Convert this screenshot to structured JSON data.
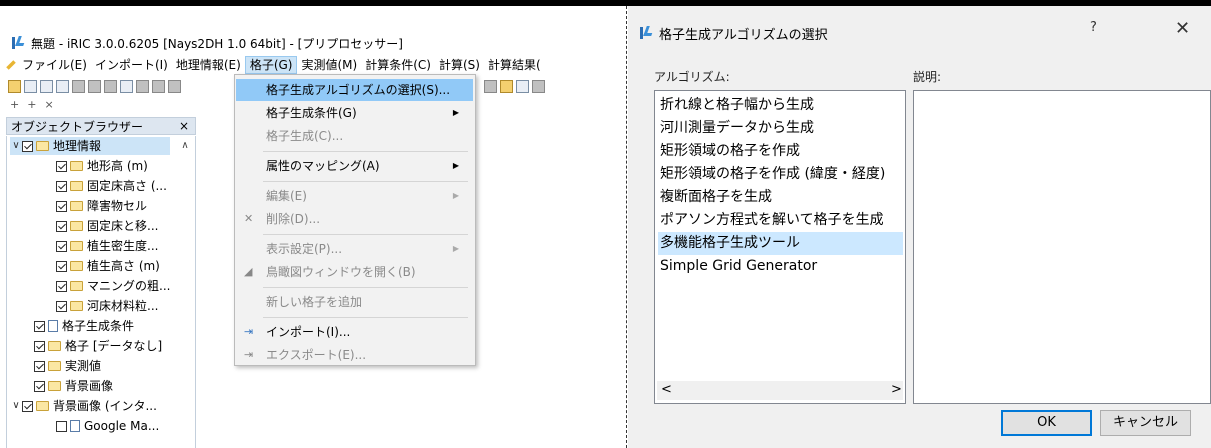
{
  "main_window": {
    "title": "無題 - iRIC 3.0.0.6205 [Nays2DH 1.0 64bit] - [プリプロセッサー]",
    "menu": [
      "ファイル(E)",
      "インポート(I)",
      "地理情報(E)",
      "格子(G)",
      "実測値(M)",
      "計算条件(C)",
      "計算(S)",
      "計算結果("
    ],
    "toolbar2": [
      "+",
      "+",
      "×"
    ],
    "object_browser": {
      "title": "オブジェクトブラウザー",
      "close": "×",
      "items": [
        "地理情報",
        "地形高 (m)",
        "固定床高さ (...",
        "障害物セル",
        "固定床と移...",
        "植生密生度...",
        "植生高さ (m)",
        "マニングの粗...",
        "河床材料粒...",
        "格子生成条件",
        "格子 [データなし]",
        "実測値",
        "背景画像",
        "背景画像 (インタ...",
        "Google Ma..."
      ]
    }
  },
  "grid_menu": {
    "items": [
      "格子生成アルゴリズムの選択(S)...",
      "格子生成条件(G)",
      "格子生成(C)...",
      "属性のマッピング(A)",
      "編集(E)",
      "削除(D)...",
      "表示設定(P)...",
      "鳥瞰図ウィンドウを開く(B)",
      "新しい格子を追加",
      "インポート(I)...",
      "エクスポート(E)..."
    ]
  },
  "dialog": {
    "title": "格子生成アルゴリズムの選択",
    "help": "?",
    "close": "✕",
    "algorithm_label": "アルゴリズム:",
    "description_label": "説明:",
    "algorithms": [
      "折れ線と格子幅から生成",
      "河川測量データから生成",
      "矩形領域の格子を作成",
      "矩形領域の格子を作成 (緯度・経度)",
      "複断面格子を生成",
      "ポアソン方程式を解いて格子を生成",
      "多機能格子生成ツール",
      "Simple Grid Generator"
    ],
    "selected_index": 6,
    "ok": "OK",
    "cancel": "キャンセル",
    "scroll_left": "<",
    "scroll_right": ">"
  },
  "colors": {
    "menu_highlight": "#91c9f7",
    "list_selection": "#cce8ff",
    "ok_border": "#0078d7"
  }
}
